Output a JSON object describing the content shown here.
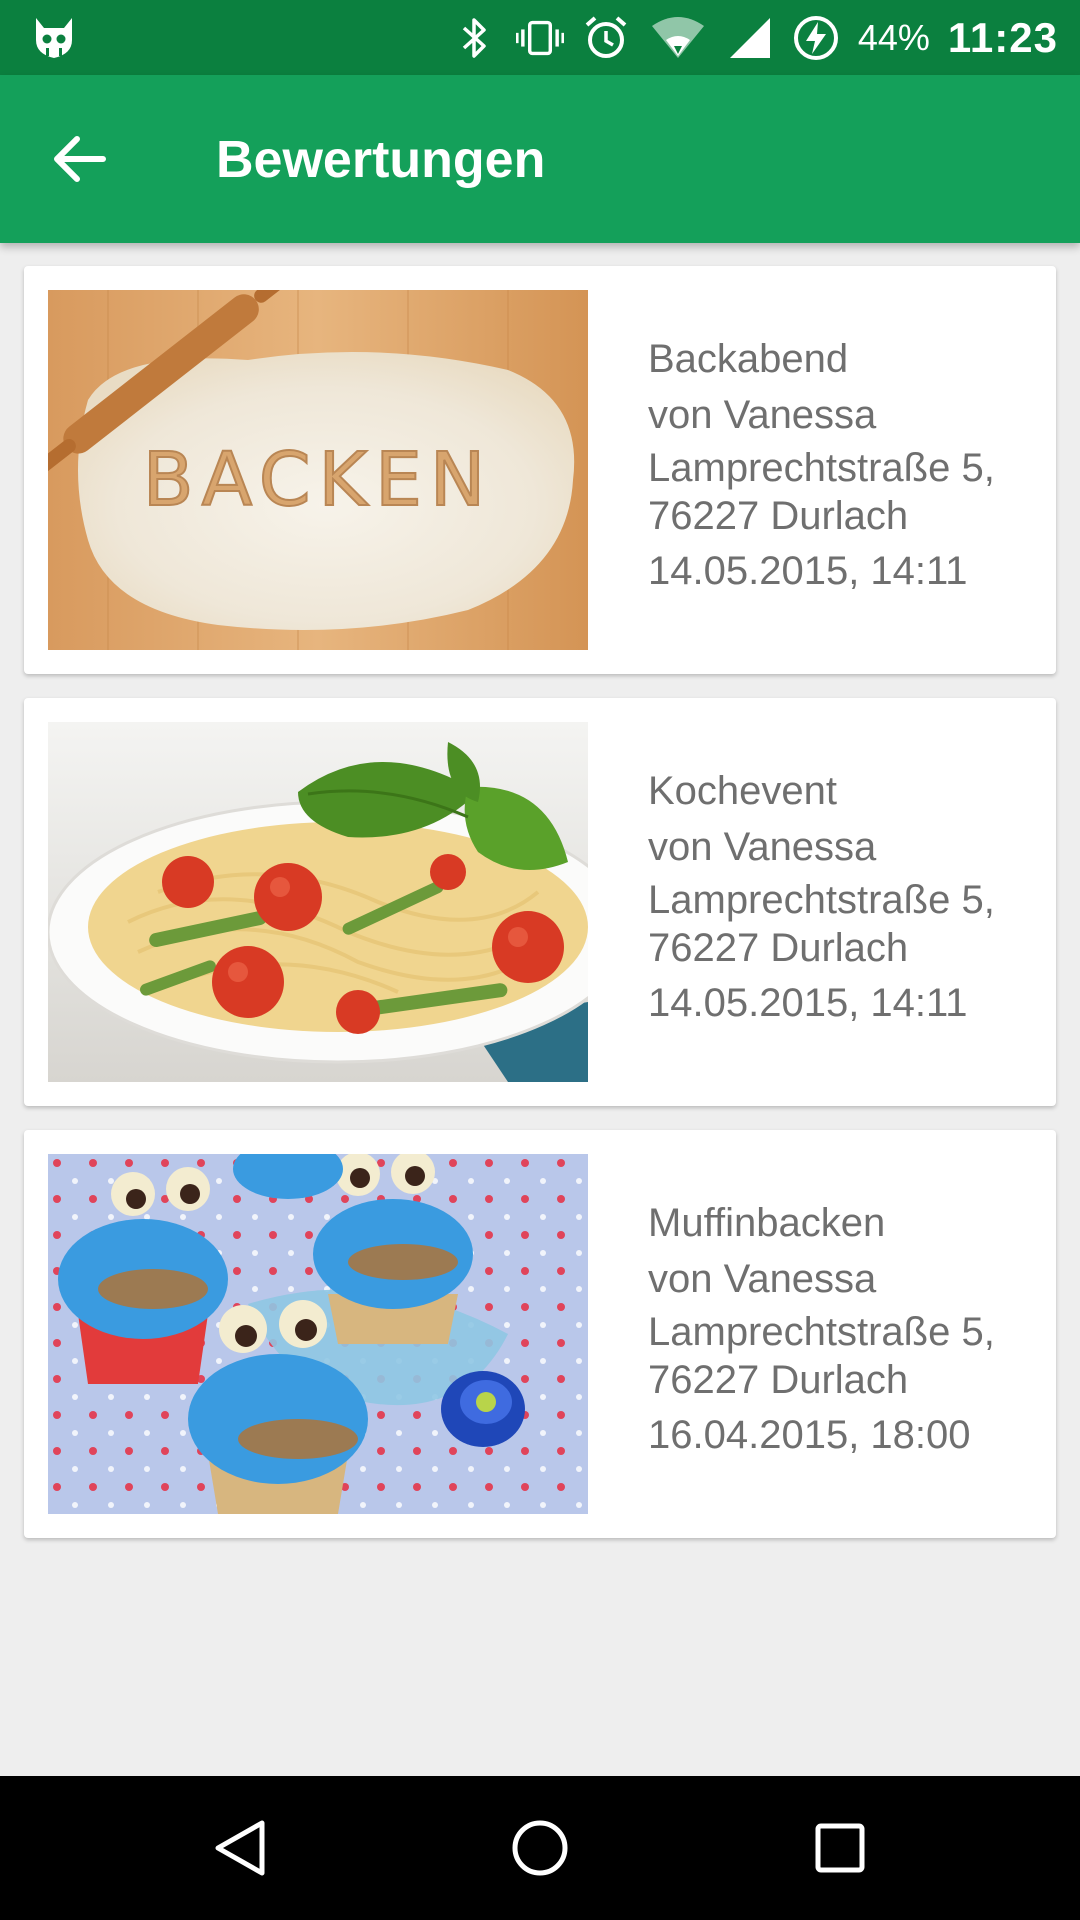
{
  "status_bar": {
    "battery": "44%",
    "time": "11:23",
    "icons": [
      "cyanogen-icon",
      "bluetooth-icon",
      "vibrate-icon",
      "alarm-icon",
      "wifi-icon",
      "signal-icon",
      "battery-charging-icon"
    ]
  },
  "app_bar": {
    "title": "Bewertungen",
    "back_icon": "arrow-back-icon"
  },
  "items": [
    {
      "title": "Backabend",
      "host": "von Vanessa",
      "street": "Lamprechtstraße 5,",
      "city": "76227 Durlach",
      "datetime": "14.05.2015, 14:11",
      "image_word": "BACKEN"
    },
    {
      "title": "Kochevent",
      "host": "von Vanessa",
      "street": "Lamprechtstraße 5,",
      "city": "76227 Durlach",
      "datetime": "14.05.2015, 14:11"
    },
    {
      "title": "Muffinbacken",
      "host": "von Vanessa",
      "street": "Lamprechtstraße 5,",
      "city": "76227 Durlach",
      "datetime": "16.04.2015, 18:00"
    }
  ],
  "nav_bar": {
    "buttons": [
      "back-triangle-icon",
      "home-circle-icon",
      "recents-square-icon"
    ]
  },
  "colors": {
    "status_bar": "#0b803f",
    "app_bar": "#14a05a",
    "background": "#eeeeee",
    "card_text": "#6f6f6f"
  }
}
